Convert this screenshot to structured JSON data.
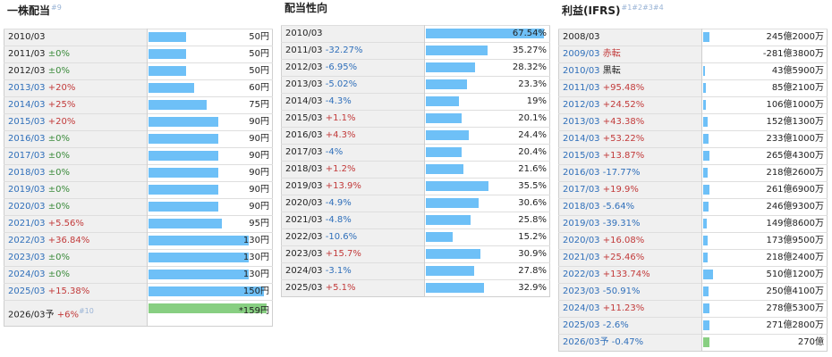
{
  "dividend": {
    "title": "一株配当",
    "title_note": "#9",
    "rows": [
      {
        "year": "2010/03",
        "change": "",
        "dir": "none",
        "value": "50円",
        "ratio": 0.32,
        "link": false
      },
      {
        "year": "2011/03",
        "change": "±0%",
        "dir": "flat",
        "value": "50円",
        "ratio": 0.32,
        "link": false
      },
      {
        "year": "2012/03",
        "change": "±0%",
        "dir": "flat",
        "value": "50円",
        "ratio": 0.32,
        "link": false
      },
      {
        "year": "2013/03",
        "change": "+20%",
        "dir": "up",
        "value": "60円",
        "ratio": 0.39,
        "link": true
      },
      {
        "year": "2014/03",
        "change": "+25%",
        "dir": "up",
        "value": "75円",
        "ratio": 0.49,
        "link": true
      },
      {
        "year": "2015/03",
        "change": "+20%",
        "dir": "up",
        "value": "90円",
        "ratio": 0.59,
        "link": true
      },
      {
        "year": "2016/03",
        "change": "±0%",
        "dir": "flat",
        "value": "90円",
        "ratio": 0.59,
        "link": true
      },
      {
        "year": "2017/03",
        "change": "±0%",
        "dir": "flat",
        "value": "90円",
        "ratio": 0.59,
        "link": true
      },
      {
        "year": "2018/03",
        "change": "±0%",
        "dir": "flat",
        "value": "90円",
        "ratio": 0.59,
        "link": true
      },
      {
        "year": "2019/03",
        "change": "±0%",
        "dir": "flat",
        "value": "90円",
        "ratio": 0.59,
        "link": true
      },
      {
        "year": "2020/03",
        "change": "±0%",
        "dir": "flat",
        "value": "90円",
        "ratio": 0.59,
        "link": true
      },
      {
        "year": "2021/03",
        "change": "+5.56%",
        "dir": "up",
        "value": "95円",
        "ratio": 0.62,
        "link": true
      },
      {
        "year": "2022/03",
        "change": "+36.84%",
        "dir": "up",
        "value": "130円",
        "ratio": 0.85,
        "link": true
      },
      {
        "year": "2023/03",
        "change": "±0%",
        "dir": "flat",
        "value": "130円",
        "ratio": 0.85,
        "link": true
      },
      {
        "year": "2024/03",
        "change": "±0%",
        "dir": "flat",
        "value": "130円",
        "ratio": 0.85,
        "link": true
      },
      {
        "year": "2025/03",
        "change": "+15.38%",
        "dir": "up",
        "value": "150円",
        "ratio": 0.98,
        "link": true
      },
      {
        "year": "2026/03予",
        "change": "+6%",
        "dir": "up",
        "value": "159円",
        "ratio": 1.0,
        "link": false,
        "estimate": true,
        "note": "#10",
        "marker": "*"
      }
    ]
  },
  "payout": {
    "title": "配当性向",
    "rows": [
      {
        "year": "2010/03",
        "change": "",
        "dir": "none",
        "value": "67.54%",
        "ratio": 1.0
      },
      {
        "year": "2011/03",
        "change": "-32.27%",
        "dir": "down",
        "value": "35.27%",
        "ratio": 0.52
      },
      {
        "year": "2012/03",
        "change": "-6.95%",
        "dir": "down",
        "value": "28.32%",
        "ratio": 0.42
      },
      {
        "year": "2013/03",
        "change": "-5.02%",
        "dir": "down",
        "value": "23.3%",
        "ratio": 0.345
      },
      {
        "year": "2014/03",
        "change": "-4.3%",
        "dir": "down",
        "value": "19%",
        "ratio": 0.28
      },
      {
        "year": "2015/03",
        "change": "+1.1%",
        "dir": "up",
        "value": "20.1%",
        "ratio": 0.3
      },
      {
        "year": "2016/03",
        "change": "+4.3%",
        "dir": "up",
        "value": "24.4%",
        "ratio": 0.36
      },
      {
        "year": "2017/03",
        "change": "-4%",
        "dir": "down",
        "value": "20.4%",
        "ratio": 0.3
      },
      {
        "year": "2018/03",
        "change": "+1.2%",
        "dir": "up",
        "value": "21.6%",
        "ratio": 0.32
      },
      {
        "year": "2019/03",
        "change": "+13.9%",
        "dir": "up",
        "value": "35.5%",
        "ratio": 0.53
      },
      {
        "year": "2020/03",
        "change": "-4.9%",
        "dir": "down",
        "value": "30.6%",
        "ratio": 0.45
      },
      {
        "year": "2021/03",
        "change": "-4.8%",
        "dir": "down",
        "value": "25.8%",
        "ratio": 0.38
      },
      {
        "year": "2022/03",
        "change": "-10.6%",
        "dir": "down",
        "value": "15.2%",
        "ratio": 0.225
      },
      {
        "year": "2023/03",
        "change": "+15.7%",
        "dir": "up",
        "value": "30.9%",
        "ratio": 0.46
      },
      {
        "year": "2024/03",
        "change": "-3.1%",
        "dir": "down",
        "value": "27.8%",
        "ratio": 0.41
      },
      {
        "year": "2025/03",
        "change": "+5.1%",
        "dir": "up",
        "value": "32.9%",
        "ratio": 0.49
      }
    ]
  },
  "profit": {
    "title": "利益(IFRS)",
    "title_note": "#1#2#3#4",
    "rows": [
      {
        "year": "2008/03",
        "change": "",
        "dir": "none",
        "value": "245億2000万",
        "ratio": 0.05,
        "link": false
      },
      {
        "year": "2009/03",
        "change": "赤転",
        "dir": "up",
        "value": "-281億3800万",
        "ratio": 0.0,
        "link": true
      },
      {
        "year": "2010/03",
        "change": "黒転",
        "dir": "black",
        "value": "43億5900万",
        "ratio": 0.01,
        "link": true
      },
      {
        "year": "2011/03",
        "change": "+95.48%",
        "dir": "up",
        "value": "85億2100万",
        "ratio": 0.02,
        "link": true
      },
      {
        "year": "2012/03",
        "change": "+24.52%",
        "dir": "up",
        "value": "106億1000万",
        "ratio": 0.025,
        "link": true
      },
      {
        "year": "2013/03",
        "change": "+43.38%",
        "dir": "up",
        "value": "152億1300万",
        "ratio": 0.035,
        "link": true
      },
      {
        "year": "2014/03",
        "change": "+53.22%",
        "dir": "up",
        "value": "233億1000万",
        "ratio": 0.045,
        "link": true
      },
      {
        "year": "2015/03",
        "change": "+13.87%",
        "dir": "up",
        "value": "265億4300万",
        "ratio": 0.05,
        "link": true
      },
      {
        "year": "2016/03",
        "change": "-17.77%",
        "dir": "down",
        "value": "218億2600万",
        "ratio": 0.04,
        "link": true
      },
      {
        "year": "2017/03",
        "change": "+19.9%",
        "dir": "up",
        "value": "261億6900万",
        "ratio": 0.05,
        "link": true
      },
      {
        "year": "2018/03",
        "change": "-5.64%",
        "dir": "down",
        "value": "246億9300万",
        "ratio": 0.048,
        "link": true
      },
      {
        "year": "2019/03",
        "change": "-39.31%",
        "dir": "down",
        "value": "149億8600万",
        "ratio": 0.03,
        "link": true
      },
      {
        "year": "2020/03",
        "change": "+16.08%",
        "dir": "up",
        "value": "173億9500万",
        "ratio": 0.035,
        "link": true
      },
      {
        "year": "2021/03",
        "change": "+25.46%",
        "dir": "up",
        "value": "218億2400万",
        "ratio": 0.04,
        "link": true
      },
      {
        "year": "2022/03",
        "change": "+133.74%",
        "dir": "up",
        "value": "510億1200万",
        "ratio": 0.085,
        "link": true
      },
      {
        "year": "2023/03",
        "change": "-50.91%",
        "dir": "down",
        "value": "250億4100万",
        "ratio": 0.048,
        "link": true
      },
      {
        "year": "2024/03",
        "change": "+11.23%",
        "dir": "up",
        "value": "278億5300万",
        "ratio": 0.05,
        "link": true
      },
      {
        "year": "2025/03",
        "change": "-2.6%",
        "dir": "down",
        "value": "271億2800万",
        "ratio": 0.05,
        "link": true
      },
      {
        "year": "2026/03予",
        "change": "-0.47%",
        "dir": "down",
        "value": "270億",
        "ratio": 0.05,
        "link": true,
        "estimate": true
      }
    ]
  }
}
